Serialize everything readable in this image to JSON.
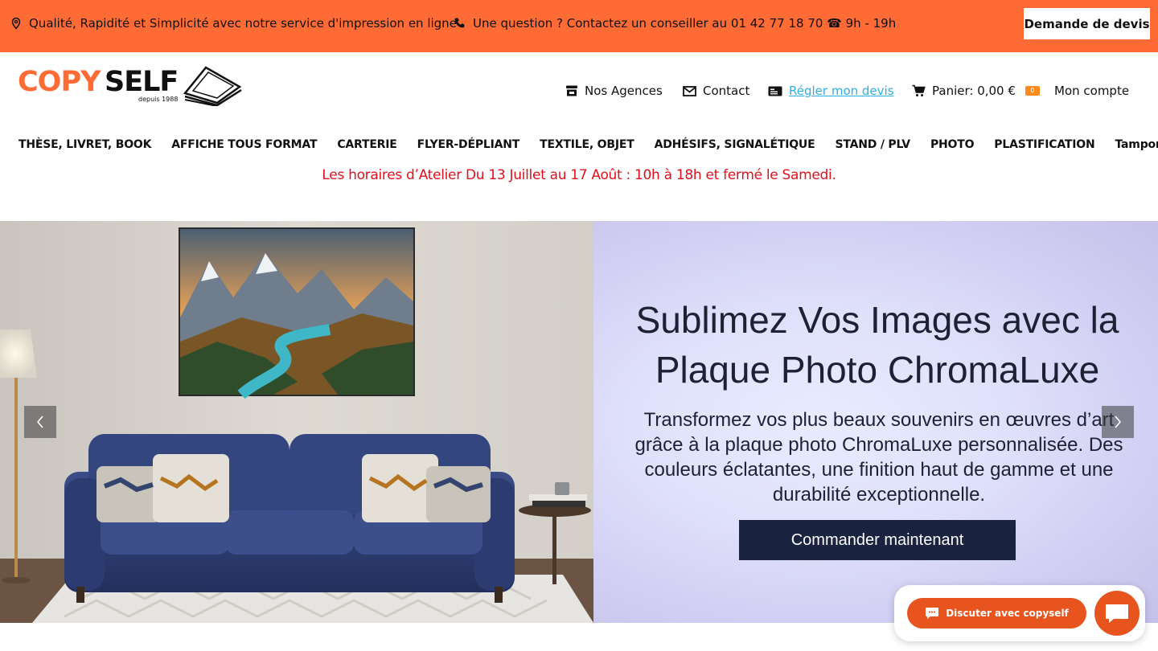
{
  "topbar": {
    "tagline": "Qualité, Rapidité et Simplicité avec notre service d'impression en ligne",
    "contact": "Une question ? Contactez un conseiller au 01 42 77 18 70 ☎ 9h - 19h",
    "quote_button": "Demande de devis"
  },
  "logo": {
    "part1": "COPY",
    "part2": "SELF",
    "since": "depuis 1988"
  },
  "utility_nav": {
    "agences": "Nos Agences",
    "contact": "Contact",
    "devis": "Régler mon devis",
    "panier": "Panier: 0,00 €",
    "cart_count": "0",
    "compte": "Mon compte"
  },
  "main_nav": [
    "THÈSE, LIVRET, BOOK",
    "AFFICHE TOUS FORMAT",
    "CARTERIE",
    "FLYER-DÉPLIANT",
    "TEXTILE, OBJET",
    "ADHÉSIFS, SIGNALÉTIQUE",
    "STAND / PLV",
    "PHOTO",
    "PLASTIFICATION",
    "Tampon"
  ],
  "notice": "Les horaires d’Atelier Du 13 Juillet au 17 Août : 10h à 18h et fermé le Samedi.",
  "hero": {
    "title": "Sublimez Vos Images avec la Plaque Photo ChromaLuxe",
    "subtitle": "Transformez vos plus beaux souvenirs en œuvres d’art grâce à la plaque photo ChromaLuxe personnalisée. Des couleurs éclatantes, une finition haut de gamme et une durabilité exceptionnelle.",
    "cta": "Commander maintenant"
  },
  "chat": {
    "label": "Discuter avec copyself"
  },
  "colors": {
    "brand_orange": "#ff6b35",
    "notice_red": "#e0101c",
    "link_blue": "#2bb0e6",
    "navy": "#1a2340",
    "chat_orange": "#e8541e"
  }
}
